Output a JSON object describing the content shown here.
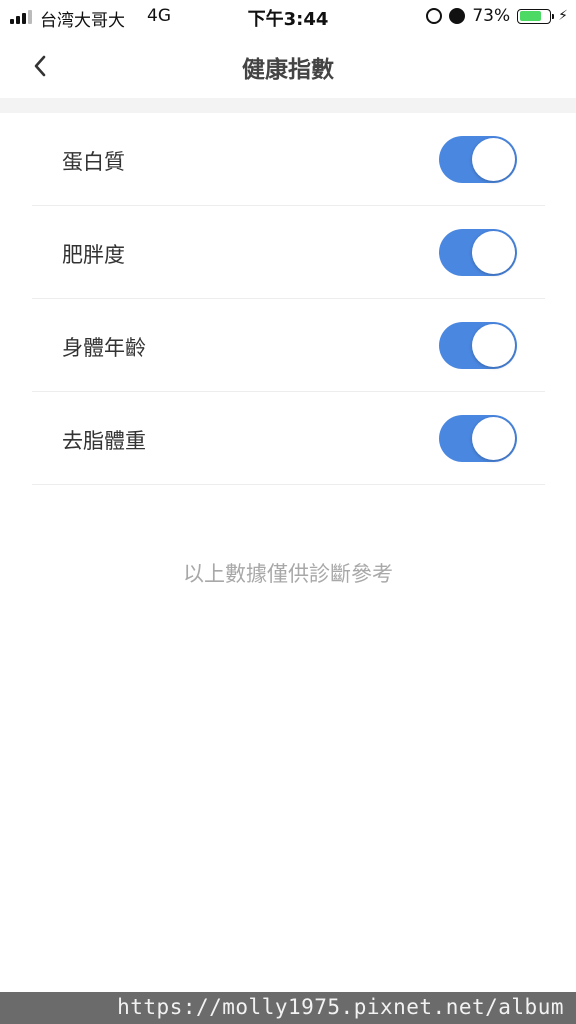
{
  "status_bar": {
    "carrier": "台湾大哥大",
    "network": "4G",
    "time": "下午3:44",
    "battery": "73%",
    "battery_level": 0.73,
    "icons": [
      "signal-icon",
      "orientation-lock-icon",
      "alarm-icon",
      "battery-icon",
      "charging-bolt-icon"
    ]
  },
  "nav": {
    "title": "健康指數",
    "back_icon": "chevron-left-icon"
  },
  "items": [
    {
      "label": "蛋白質",
      "enabled": true
    },
    {
      "label": "肥胖度",
      "enabled": true
    },
    {
      "label": "身體年齡",
      "enabled": true
    },
    {
      "label": "去脂體重",
      "enabled": true
    }
  ],
  "footnote": "以上數據僅供診斷參考",
  "watermark": "https://molly1975.pixnet.net/album",
  "colors": {
    "toggle_on": "#4a87e0",
    "battery_fill": "#4cd964",
    "footnote": "#a8a8a8"
  }
}
